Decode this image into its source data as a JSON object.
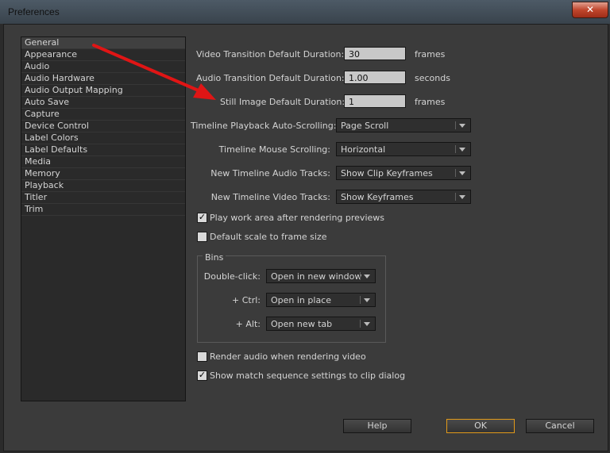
{
  "window": {
    "title": "Preferences",
    "close": "✕"
  },
  "sidebar": {
    "items": [
      "General",
      "Appearance",
      "Audio",
      "Audio Hardware",
      "Audio Output Mapping",
      "Auto Save",
      "Capture",
      "Device Control",
      "Label Colors",
      "Label Defaults",
      "Media",
      "Memory",
      "Playback",
      "Titler",
      "Trim"
    ],
    "selected": "General"
  },
  "durations": {
    "video_label": "Video Transition Default Duration:",
    "video_value": "30",
    "video_unit": "frames",
    "audio_label": "Audio Transition Default Duration:",
    "audio_value": "1.00",
    "audio_unit": "seconds",
    "still_label": "Still Image Default Duration:",
    "still_value": "1",
    "still_unit": "frames"
  },
  "timeline": {
    "autoscroll_label": "Timeline Playback Auto-Scrolling:",
    "autoscroll_value": "Page Scroll",
    "mouse_label": "Timeline Mouse Scrolling:",
    "mouse_value": "Horizontal",
    "audio_tracks_label": "New Timeline Audio Tracks:",
    "audio_tracks_value": "Show Clip Keyframes",
    "video_tracks_label": "New Timeline Video Tracks:",
    "video_tracks_value": "Show Keyframes"
  },
  "checks": {
    "play_work_area": {
      "label": "Play work area after rendering previews",
      "checked": true
    },
    "default_scale": {
      "label": "Default scale to frame size",
      "checked": false
    },
    "render_audio": {
      "label": "Render audio when rendering video",
      "checked": false
    },
    "show_match": {
      "label": "Show match sequence settings to clip dialog",
      "checked": true
    }
  },
  "bins": {
    "title": "Bins",
    "dbl_label": "Double-click:",
    "dbl_value": "Open in new window",
    "ctrl_label": "+ Ctrl:",
    "ctrl_value": "Open in place",
    "alt_label": "+ Alt:",
    "alt_value": "Open new tab"
  },
  "buttons": {
    "help": "Help",
    "ok": "OK",
    "cancel": "Cancel"
  },
  "colors": {
    "annotation_arrow": "#e01515",
    "ok_border": "#e29a1a"
  },
  "check_glyph": "✓"
}
